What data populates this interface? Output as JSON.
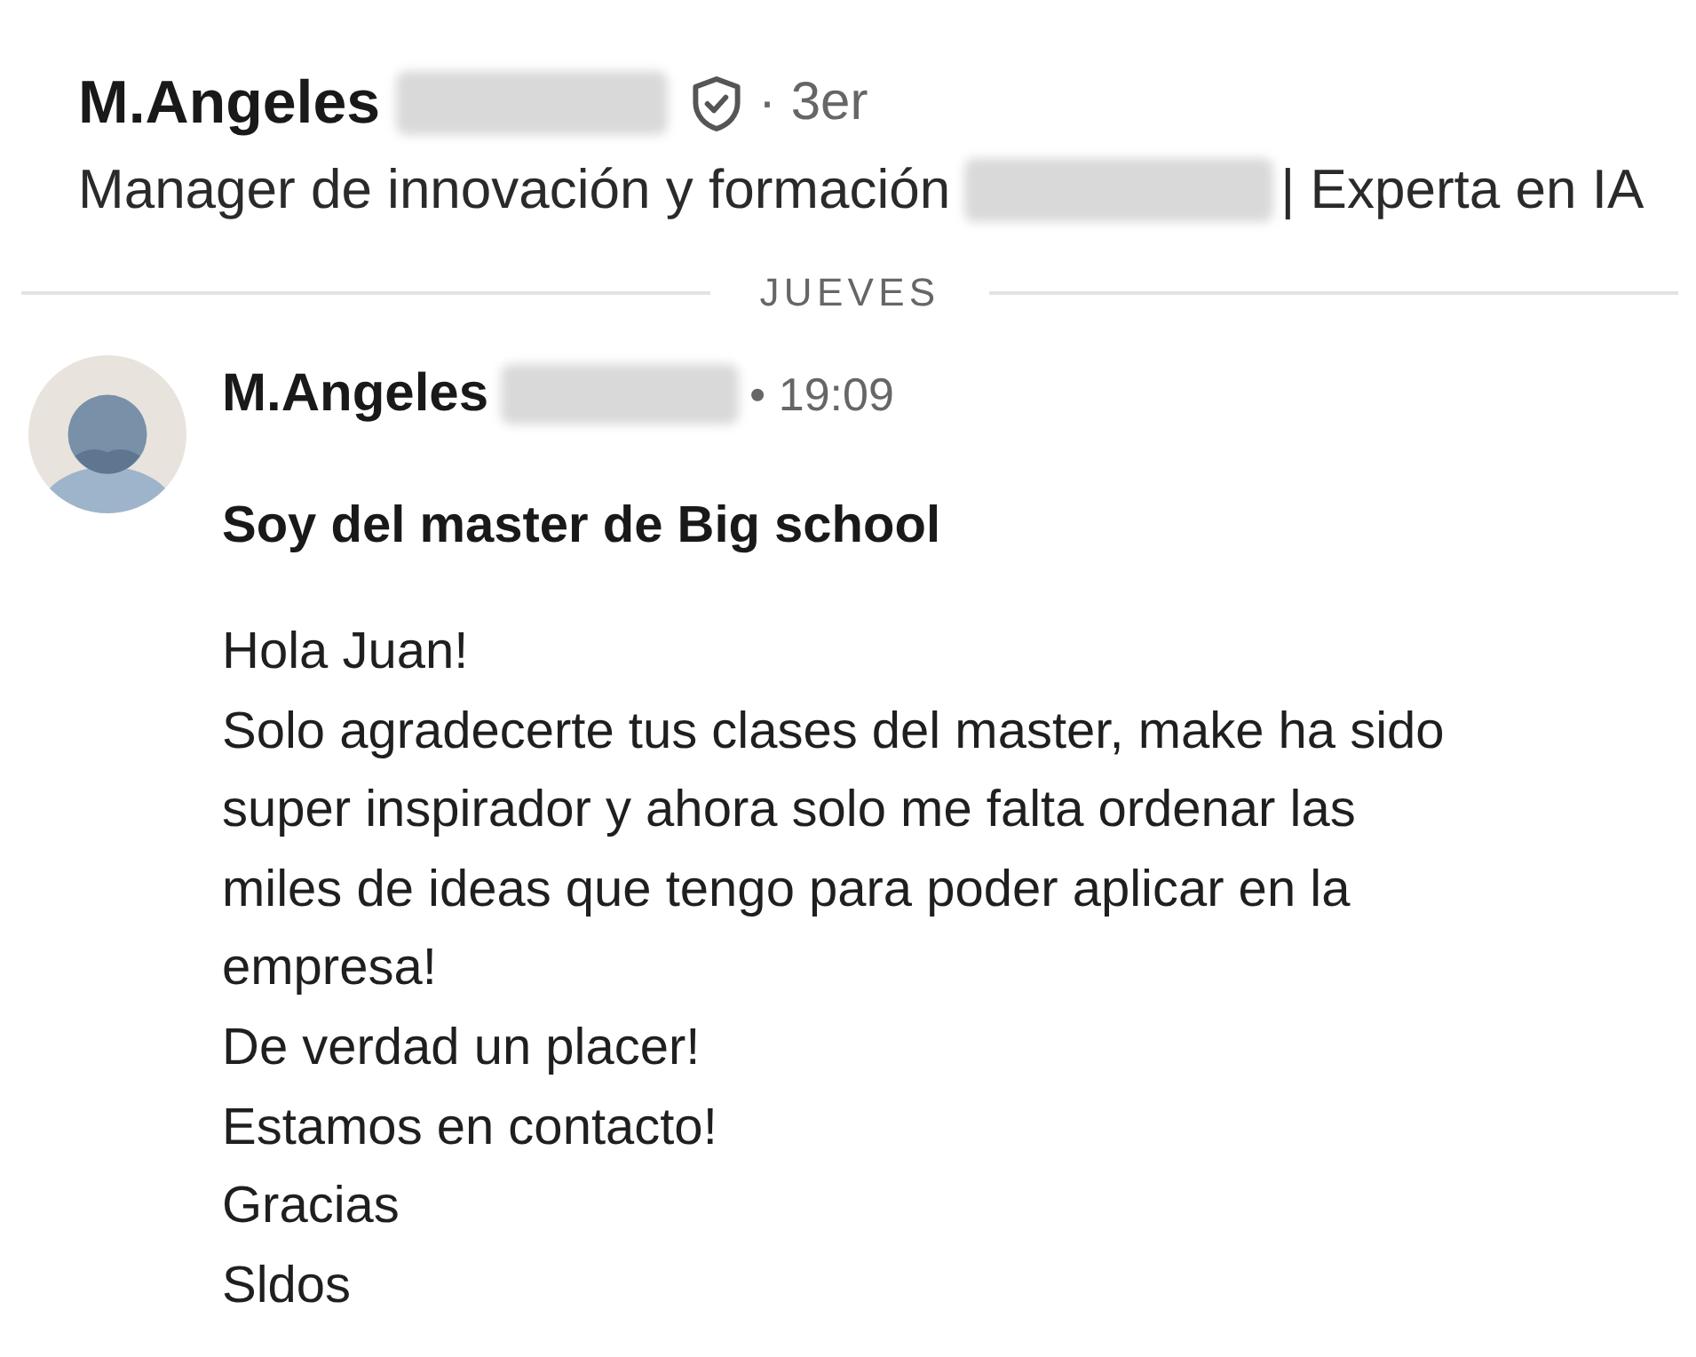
{
  "conversation_header": {
    "name": "M.Angeles",
    "verified": true,
    "connection_degree": "· 3er",
    "headline": "Manager de innovación y formación",
    "headline_suffix": "| Experta en IA"
  },
  "date_divider": {
    "label": "JUEVES"
  },
  "messages": [
    {
      "sender": "M.Angeles",
      "time": "• 19:09",
      "subject": "Soy del master de Big school",
      "body": [
        "Hola Juan!",
        "Solo agradecerte tus clases del master, make ha sido super inspirador y ahora solo me falta ordenar las miles de ideas que tengo para poder aplicar en la empresa!",
        "De verdad un placer!",
        "Estamos en contacto!",
        "Gracias",
        "Sldos"
      ]
    }
  ]
}
